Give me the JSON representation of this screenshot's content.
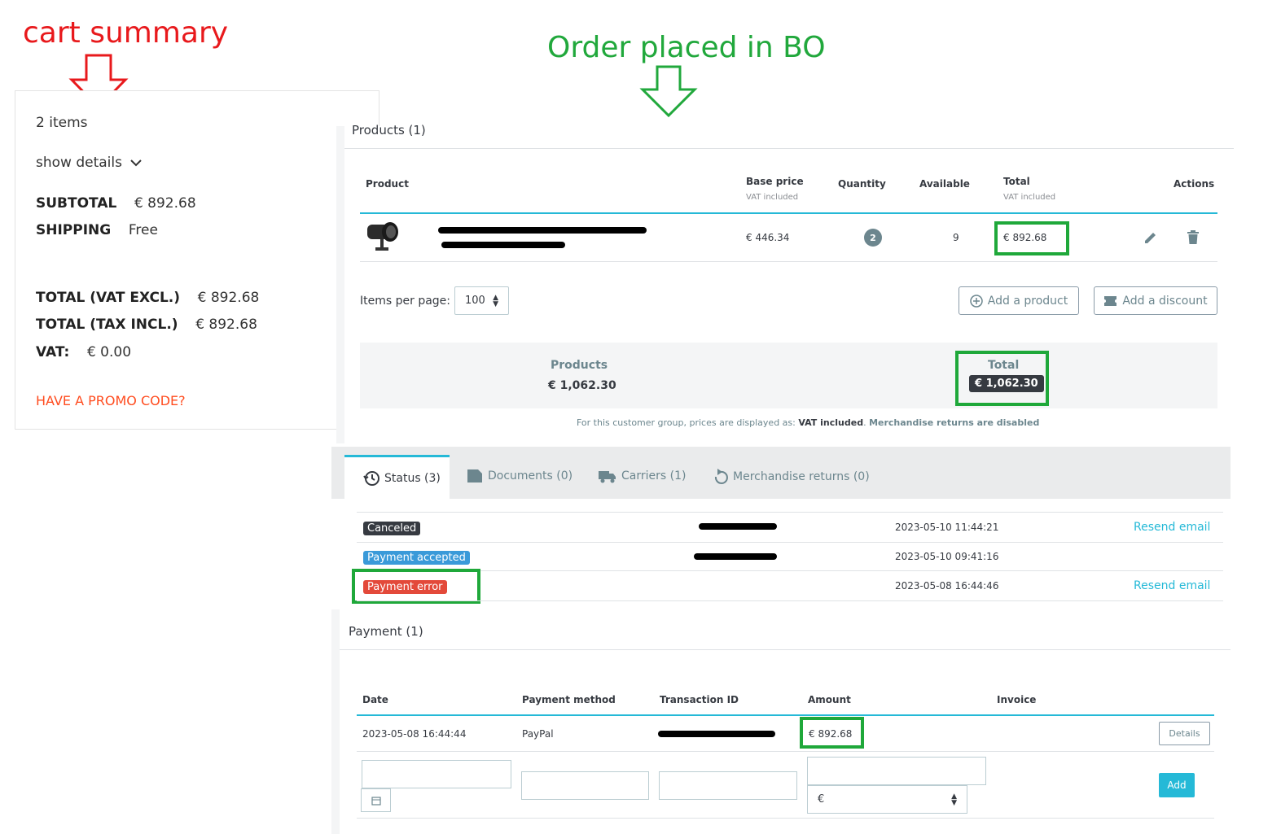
{
  "annotations": {
    "cart_label": "cart summary",
    "bo_label": "Order placed in BO"
  },
  "cart": {
    "items": "2 items",
    "show_details": "show details",
    "subtotal_label": "SUBTOTAL",
    "subtotal_value": "€ 892.68",
    "shipping_label": "SHIPPING",
    "shipping_value": "Free",
    "total_excl_label": "TOTAL (VAT EXCL.)",
    "total_excl_value": "€ 892.68",
    "total_incl_label": "TOTAL (TAX INCL.)",
    "total_incl_value": "€ 892.68",
    "vat_label": "VAT:",
    "vat_value": "€ 0.00",
    "promo": "HAVE A PROMO CODE?"
  },
  "products": {
    "title": "Products (1)",
    "headers": {
      "product": "Product",
      "base_price": "Base price",
      "base_price_sub": "VAT included",
      "quantity": "Quantity",
      "available": "Available",
      "total": "Total",
      "total_sub": "VAT included",
      "actions": "Actions"
    },
    "row": {
      "base_price": "€ 446.34",
      "quantity": "2",
      "available": "9",
      "total": "€ 892.68"
    },
    "items_per_page_label": "Items per page:",
    "items_per_page_value": "100",
    "add_product": "Add a product",
    "add_discount": "Add a discount",
    "summary_products_label": "Products",
    "summary_products_value": "€ 1,062.30",
    "summary_total_label": "Total",
    "summary_total_value": "€ 1,062.30",
    "note_prefix": "For this customer group, prices are displayed as:",
    "note_bold1": "VAT included",
    "note_bold2": "Merchandise returns are disabled"
  },
  "tabs": [
    {
      "label": "Status (3)"
    },
    {
      "label": "Documents (0)"
    },
    {
      "label": "Carriers (1)"
    },
    {
      "label": "Merchandise returns (0)"
    }
  ],
  "status_rows": [
    {
      "status": "Canceled",
      "color": "#363a41",
      "date": "2023-05-10 11:44:21",
      "action": "Resend email"
    },
    {
      "status": "Payment accepted",
      "color": "#3a9ad9",
      "date": "2023-05-10 09:41:16",
      "action": ""
    },
    {
      "status": "Payment error",
      "color": "#e3493a",
      "date": "2023-05-08 16:44:46",
      "action": "Resend email"
    }
  ],
  "payment": {
    "title": "Payment (1)",
    "headers": {
      "date": "Date",
      "method": "Payment method",
      "transaction": "Transaction ID",
      "amount": "Amount",
      "invoice": "Invoice"
    },
    "row": {
      "date": "2023-05-08 16:44:44",
      "method": "PayPal",
      "amount": "€ 892.68"
    },
    "details_btn": "Details",
    "currency_value": "€",
    "add_btn": "Add"
  },
  "colors": {
    "accent": "#25b9d7",
    "highlight_green": "#1fa83a",
    "annotation_red": "#e8191c"
  }
}
